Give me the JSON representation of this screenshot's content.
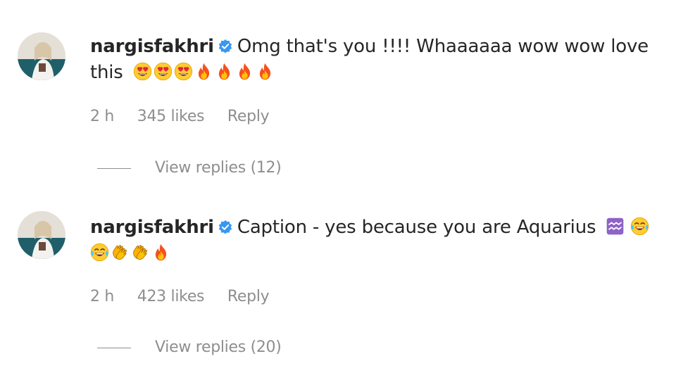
{
  "comments": [
    {
      "username": "nargisfakhri",
      "text": "Omg that's you !!!! Whaaaaaa wow wow love this",
      "emojis": [
        "heart-eyes",
        "heart-eyes",
        "heart-eyes",
        "fire",
        "fire",
        "fire",
        "fire"
      ],
      "time": "2 h",
      "likes": "345 likes",
      "reply_label": "Reply",
      "view_replies": "View replies (12)"
    },
    {
      "username": "nargisfakhri",
      "text": "Caption - yes because you are Aquarius",
      "emojis": [
        "aquarius",
        "tears-of-joy",
        "tears-of-joy",
        "clapping-hands",
        "clapping-hands",
        "fire"
      ],
      "time": "2 h",
      "likes": "423 likes",
      "reply_label": "Reply",
      "view_replies": "View replies (20)"
    }
  ],
  "colors": {
    "text": "#262626",
    "secondary": "#8e8e8e",
    "verified_badge": "#3897f0"
  }
}
